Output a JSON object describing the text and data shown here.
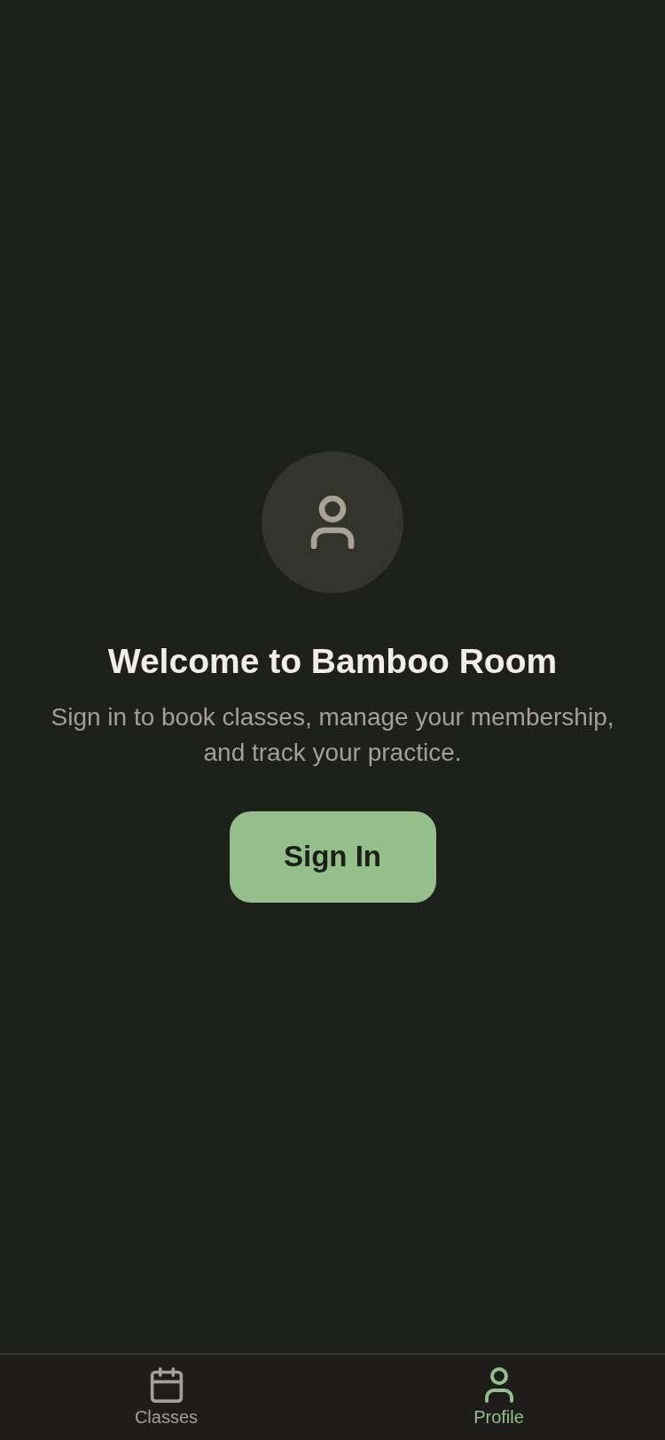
{
  "welcome": {
    "title": "Welcome to Bamboo Room",
    "message": "Sign in to book classes, manage your membership, and track your practice.",
    "button": "Sign In"
  },
  "tab_bar": {
    "tabs": [
      {
        "label": "Classes",
        "selected": false
      },
      {
        "label": "Profile",
        "selected": true
      }
    ]
  }
}
